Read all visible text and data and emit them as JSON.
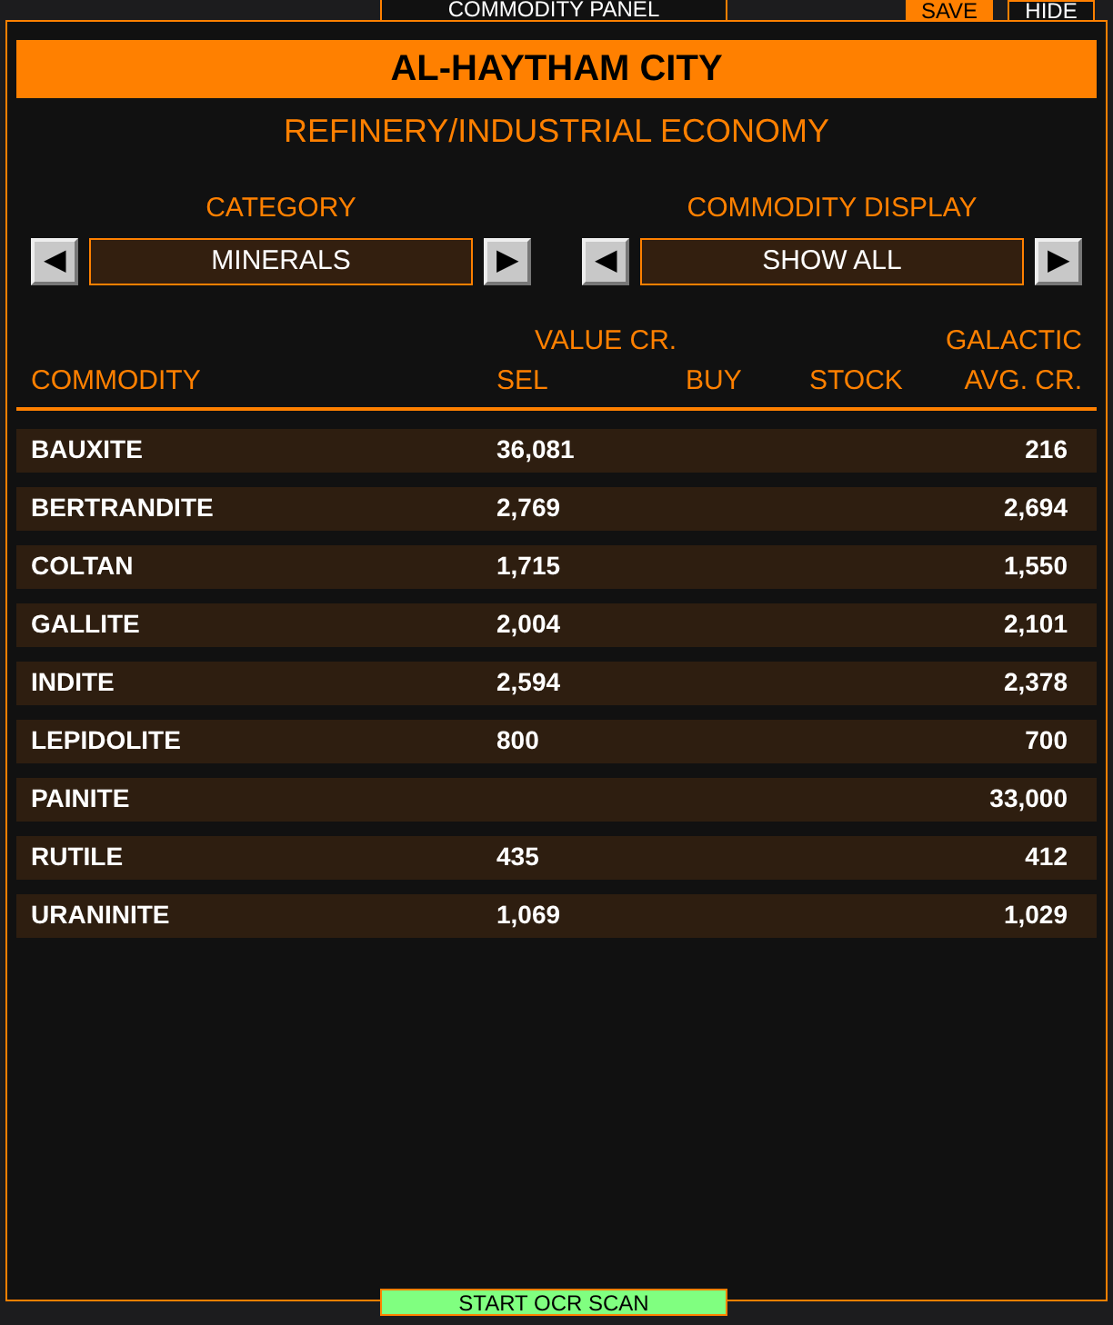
{
  "panel": {
    "title": "COMMODITY PANEL",
    "buttons": [
      {
        "label": "SAVE",
        "kind": "primary"
      },
      {
        "label": "HIDE",
        "kind": "outline"
      }
    ]
  },
  "station": {
    "name": "AL-HAYTHAM CITY",
    "economy": "REFINERY/INDUSTRIAL ECONOMY"
  },
  "selectors": [
    {
      "label": "CATEGORY",
      "value": "MINERALS",
      "prev": "◀",
      "next": "▶"
    },
    {
      "label": "COMMODITY DISPLAY",
      "value": "SHOW ALL",
      "prev": "◀",
      "next": "▶"
    }
  ],
  "table": {
    "group_header": "VALUE CR.",
    "galactic_header": "GALACTIC",
    "columns": [
      "COMMODITY",
      "SEL",
      "BUY",
      "STOCK",
      "AVG. CR."
    ],
    "rows": [
      {
        "name": "BAUXITE",
        "sell": "36,081",
        "avg": "216"
      },
      {
        "name": "BERTRANDITE",
        "sell": "2,769",
        "avg": "2,694"
      },
      {
        "name": "COLTAN",
        "sell": "1,715",
        "avg": "1,550"
      },
      {
        "name": "GALLITE",
        "sell": "2,004",
        "avg": "2,101"
      },
      {
        "name": "INDITE",
        "sell": "2,594",
        "avg": "2,378"
      },
      {
        "name": "LEPIDOLITE",
        "sell": "800",
        "avg": "700"
      },
      {
        "name": "PAINITE",
        "sell": "",
        "avg": "33,000"
      },
      {
        "name": "RUTILE",
        "sell": "435",
        "avg": "412"
      },
      {
        "name": "URANINITE",
        "sell": "1,069",
        "avg": "1,029"
      }
    ]
  },
  "scan_button": "START OCR SCAN"
}
